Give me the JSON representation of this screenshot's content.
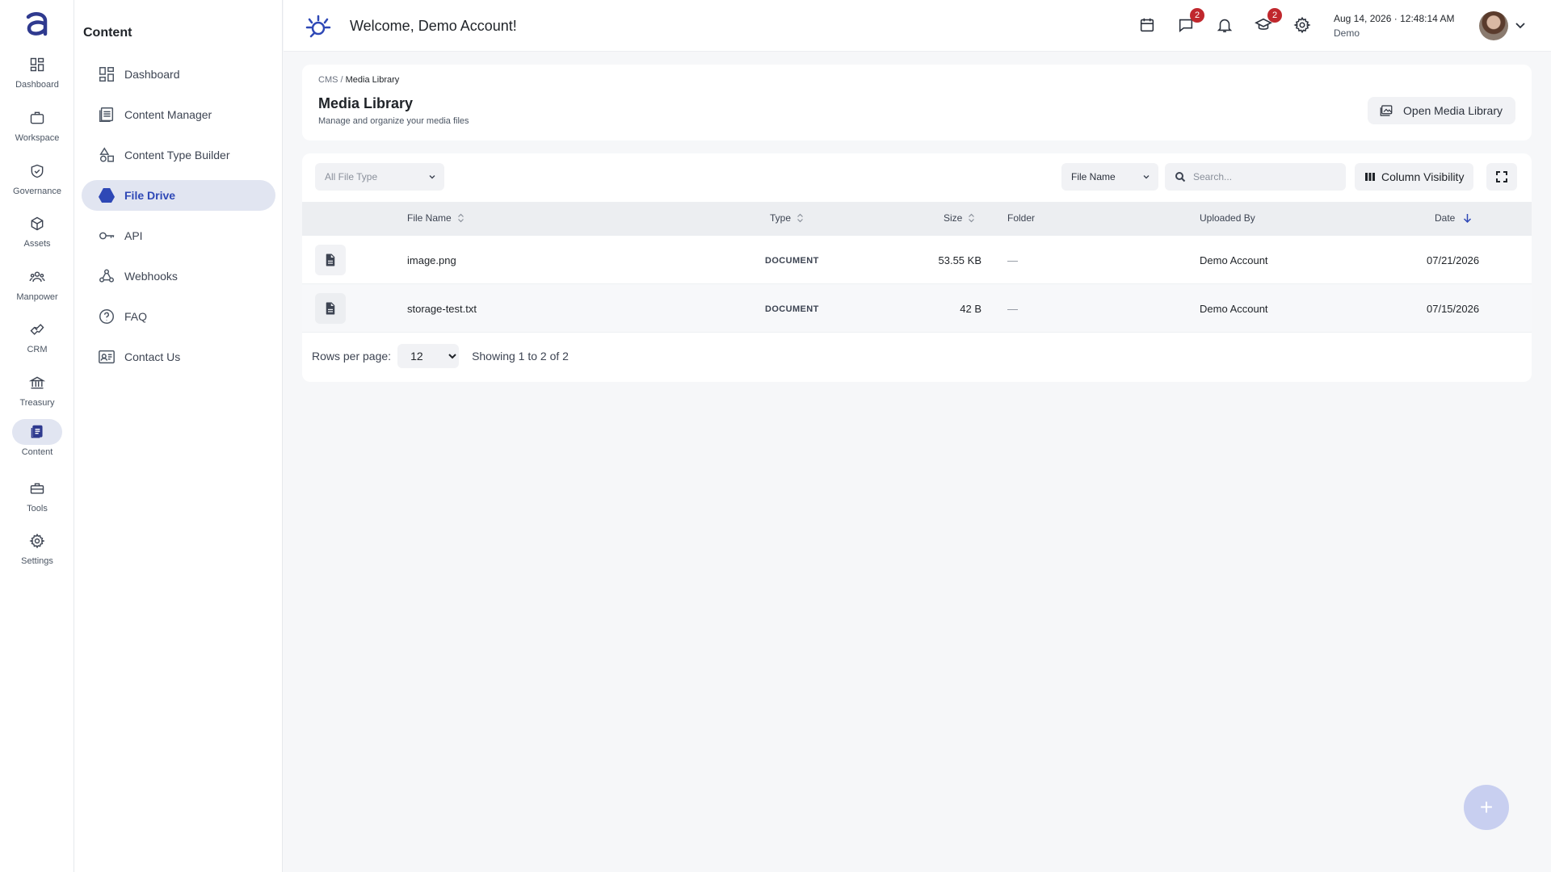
{
  "rail": {
    "items": [
      {
        "label": "Dashboard",
        "icon": "dashboard-icon"
      },
      {
        "label": "Workspace",
        "icon": "briefcase-icon"
      },
      {
        "label": "Governance",
        "icon": "shield-check-icon"
      },
      {
        "label": "Assets",
        "icon": "cube-icon"
      },
      {
        "label": "Manpower",
        "icon": "people-icon"
      },
      {
        "label": "CRM",
        "icon": "handshake-icon"
      },
      {
        "label": "Treasury",
        "icon": "bank-icon"
      },
      {
        "label": "Content",
        "icon": "document-icon"
      },
      {
        "label": "Tools",
        "icon": "toolbox-icon"
      },
      {
        "label": "Settings",
        "icon": "gear-icon"
      }
    ],
    "active": "Content"
  },
  "sidebar": {
    "title": "Content",
    "items": [
      {
        "label": "Dashboard",
        "icon": "dashboard-icon"
      },
      {
        "label": "Content Manager",
        "icon": "list-icon"
      },
      {
        "label": "Content Type Builder",
        "icon": "shapes-icon"
      },
      {
        "label": "File Drive",
        "icon": "drive-icon"
      },
      {
        "label": "API",
        "icon": "key-icon"
      },
      {
        "label": "Webhooks",
        "icon": "webhook-icon"
      },
      {
        "label": "FAQ",
        "icon": "question-icon"
      },
      {
        "label": "Contact Us",
        "icon": "contact-card-icon"
      }
    ],
    "active": "File Drive"
  },
  "topbar": {
    "welcome": "Welcome, Demo Account!",
    "messages_badge": "2",
    "learning_badge": "2",
    "date": "Aug 14, 2026",
    "separator": "·",
    "time": "12:48:14 AM",
    "user": "Demo"
  },
  "header": {
    "breadcrumb_root": "CMS",
    "breadcrumb_sep": "/",
    "breadcrumb_current": "Media Library",
    "title": "Media Library",
    "subtitle": "Manage and organize your media files",
    "open_button": "Open Media Library"
  },
  "toolbar": {
    "file_type": "All File Type",
    "sort_field": "File Name",
    "search_placeholder": "Search...",
    "column_visibility": "Column Visibility"
  },
  "table": {
    "columns": {
      "name": "File Name",
      "type": "Type",
      "size": "Size",
      "folder": "Folder",
      "uploaded_by": "Uploaded By",
      "date": "Date"
    },
    "rows": [
      {
        "name": "image.png",
        "type": "DOCUMENT",
        "size": "53.55 KB",
        "folder": "—",
        "uploaded_by": "Demo Account",
        "date": "07/21/2026"
      },
      {
        "name": "storage-test.txt",
        "type": "DOCUMENT",
        "size": "42 B",
        "folder": "—",
        "uploaded_by": "Demo Account",
        "date": "07/15/2026"
      }
    ]
  },
  "pager": {
    "rows_label": "Rows per page:",
    "rows_value": "12",
    "showing": "Showing 1 to 2 of 2"
  },
  "colors": {
    "accent": "#2e48b6",
    "active_bg": "#e1e5f1",
    "badge": "#c0272d",
    "fab": "#c8cff0"
  },
  "fab": {
    "icon": "plus-icon",
    "label": "+"
  }
}
